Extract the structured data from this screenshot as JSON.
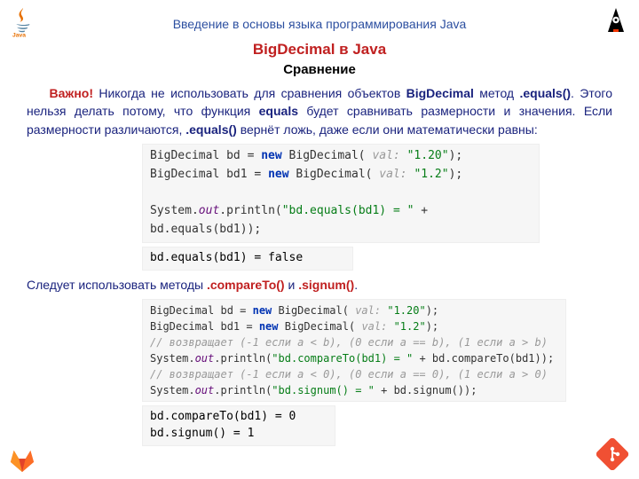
{
  "header": {
    "title": "Введение в основы языка программирования Java",
    "subtitle": "BigDecimal в Java",
    "subtitle2": "Сравнение"
  },
  "para1": {
    "important": "Важно!",
    "t1": " Никогда не использовать для сравнения объектов ",
    "b1": "BigDecimal",
    "t2": " метод ",
    "b2": ".equals()",
    "t3": ". Этого нельзя делать потому, что функция ",
    "b3": "equals",
    "t4": " будет сравнивать размерности и значения. Если размерности различаются, ",
    "b4": ".equals()",
    "t5": " вернёт ложь, даже если они математически равны:"
  },
  "code1": {
    "l1a": "BigDecimal bd = ",
    "l1b": "new",
    "l1c": " BigDecimal(",
    "l1d": " val: ",
    "l1e": "\"1.20\"",
    "l1f": ");",
    "l2a": "BigDecimal bd1 = ",
    "l2b": "new",
    "l2c": " BigDecimal(",
    "l2d": " val: ",
    "l2e": "\"1.2\"",
    "l2f": ");",
    "l3a": "System.",
    "l3b": "out",
    "l3c": ".println(",
    "l3d": "\"bd.equals(bd1) = \"",
    "l3e": " + bd.equals(bd1));"
  },
  "result1": "bd.equals(bd1) = false",
  "para2": {
    "t1": "Следует использовать методы ",
    "m1": ".compareTo()",
    "t2": " и ",
    "m2": ".signum()",
    "t3": "."
  },
  "code2": {
    "l1a": "BigDecimal bd = ",
    "l1b": "new",
    "l1c": " BigDecimal(",
    "l1d": " val: ",
    "l1e": "\"1.20\"",
    "l1f": ");",
    "l2a": "BigDecimal bd1 = ",
    "l2b": "new",
    "l2c": " BigDecimal(",
    "l2d": " val: ",
    "l2e": "\"1.2\"",
    "l2f": ");",
    "c1": "// возвращает (-1 если a < b), (0 если a == b), (1 если a > b)",
    "l3a": "System.",
    "l3b": "out",
    "l3c": ".println(",
    "l3d": "\"bd.compareTo(bd1) = \"",
    "l3e": " + bd.compareTo(bd1));",
    "c2": "// возвращает (-1 если a < 0), (0 если a == 0), (1 если a > 0)",
    "l4a": "System.",
    "l4b": "out",
    "l4c": ".println(",
    "l4d": "\"bd.signum() = \"",
    "l4e": " + bd.signum());"
  },
  "result2a": "bd.compareTo(bd1) = 0",
  "result2b": "bd.signum() = 1"
}
